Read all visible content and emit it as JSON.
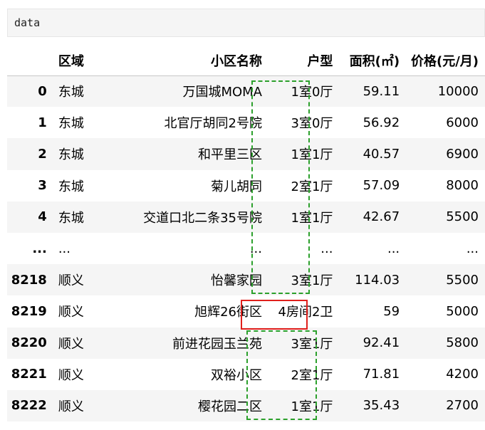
{
  "code_cell": {
    "text": "data"
  },
  "table": {
    "columns": [
      "",
      "区域",
      "小区名称",
      "户型",
      "面积(㎡)",
      "价格(元/月)"
    ],
    "rows": [
      [
        "0",
        "东城",
        "万国城MOMA",
        "1室0厅",
        "59.11",
        "10000"
      ],
      [
        "1",
        "东城",
        "北官厅胡同2号院",
        "3室0厅",
        "56.92",
        "6000"
      ],
      [
        "2",
        "东城",
        "和平里三区",
        "1室1厅",
        "40.57",
        "6900"
      ],
      [
        "3",
        "东城",
        "菊儿胡同",
        "2室1厅",
        "57.09",
        "8000"
      ],
      [
        "4",
        "东城",
        "交道口北二条35号院",
        "1室1厅",
        "42.67",
        "5500"
      ],
      [
        "...",
        "...",
        "...",
        "...",
        "...",
        "..."
      ],
      [
        "8218",
        "顺义",
        "怡馨家园",
        "3室1厅",
        "114.03",
        "5500"
      ],
      [
        "8219",
        "顺义",
        "旭辉26街区",
        "4房间2卫",
        "59",
        "5000"
      ],
      [
        "8220",
        "顺义",
        "前进花园玉兰苑",
        "3室1厅",
        "92.41",
        "5800"
      ],
      [
        "8221",
        "顺义",
        "双裕小区",
        "2室1厅",
        "71.81",
        "4200"
      ],
      [
        "8222",
        "顺义",
        "樱花园二区",
        "1室1厅",
        "35.43",
        "2700"
      ]
    ]
  },
  "highlights": {
    "normal_color": "#2ca02c",
    "anomaly_color": "#e0201c"
  }
}
